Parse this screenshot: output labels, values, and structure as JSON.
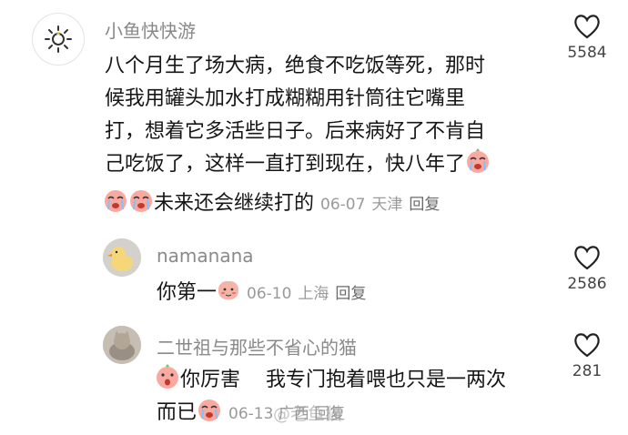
{
  "comments": [
    {
      "username": "小鱼快快游",
      "lines": [
        "八个月生了场大病，绝食不吃饭等死，那时",
        "候我用罐头加水打成糊糊用针筒往它嘴里",
        "打，想着它多活些日子。后来病好了不肯自",
        "己吃饭了，这样一直打到现在，快八年了"
      ],
      "last_text": "未来还会继续打的",
      "date": "06-07",
      "location": "天津",
      "reply_label": "回复",
      "likes": "5584",
      "emojis": [
        "crying-face-emoji",
        "crying-face-emoji",
        "crying-face-emoji"
      ]
    }
  ],
  "replies": [
    {
      "username": "namanana",
      "text": "你第一",
      "date": "06-10",
      "location": "上海",
      "reply_label": "回复",
      "likes": "2586",
      "emojis": [
        "shy-face-emoji"
      ]
    },
    {
      "username": "二世祖与那些不省心的猫",
      "text": "你厉害",
      "text2": "我专门抱着喂也只是一两次",
      "line2": "而已",
      "meta_visible": "06-13 广西 回复",
      "likes": "281",
      "emojis": [
        "surprised-face-emoji",
        "crying-face-emoji"
      ]
    }
  ],
  "watermark": "@老鱼猫",
  "colors": {
    "username": "#8a8a8a",
    "text": "#161616",
    "meta": "#9a9a9a",
    "emoji": "#f28b82"
  }
}
